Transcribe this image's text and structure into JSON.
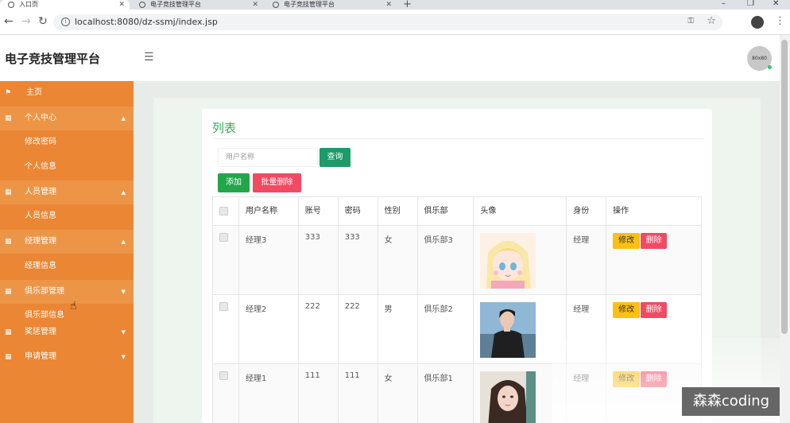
{
  "browser": {
    "tabs": [
      {
        "title": "入口页"
      },
      {
        "title": "电子竞技管理平台"
      },
      {
        "title": "电子竞技管理平台"
      }
    ],
    "new_tab": "+",
    "url": "localhost:8080/dz-ssmj/index.jsp",
    "window_controls": {
      "minimize": "–",
      "restore": "❐",
      "close": "✕"
    }
  },
  "header": {
    "brand": "电子竞技管理平台",
    "avatar_text": "80x80"
  },
  "sidebar": {
    "items": [
      {
        "label": "主页",
        "icon": "flag-icon",
        "type": "top"
      },
      {
        "label": "个人中心",
        "icon": "grid-icon",
        "type": "group"
      },
      {
        "label": "修改密码",
        "type": "sub"
      },
      {
        "label": "个人信息",
        "type": "sub"
      },
      {
        "label": "人员管理",
        "icon": "grid-icon",
        "type": "group"
      },
      {
        "label": "人员信息",
        "type": "sub"
      },
      {
        "label": "经理管理",
        "icon": "grid-icon",
        "type": "group"
      },
      {
        "label": "经理信息",
        "type": "sub"
      },
      {
        "label": "俱乐部管理",
        "icon": "grid-icon",
        "type": "group"
      },
      {
        "label": "俱乐部信息",
        "type": "sub"
      },
      {
        "label": "奖惩管理",
        "icon": "grid-icon",
        "type": "group"
      },
      {
        "label": "申请管理",
        "icon": "grid-icon",
        "type": "group"
      }
    ]
  },
  "main": {
    "title": "列表",
    "search": {
      "placeholder": "用户名称",
      "button": "查询"
    },
    "actions": {
      "add": "添加",
      "batch_delete": "批量删除"
    },
    "table": {
      "columns": [
        "用户名称",
        "账号",
        "密码",
        "性别",
        "俱乐部",
        "头像",
        "身份",
        "操作"
      ],
      "rows": [
        {
          "name": "经理3",
          "account": "333",
          "password": "333",
          "gender": "女",
          "club": "俱乐部3",
          "avatar": "anime-girl-avatar",
          "role": "经理"
        },
        {
          "name": "经理2",
          "account": "222",
          "password": "222",
          "gender": "男",
          "club": "俱乐部2",
          "avatar": "young-man-photo",
          "role": "经理"
        },
        {
          "name": "经理1",
          "account": "111",
          "password": "111",
          "gender": "女",
          "club": "俱乐部1",
          "avatar": "woman-illustration",
          "role": "经理"
        }
      ],
      "row_actions": {
        "edit": "修改",
        "delete": "删除"
      }
    }
  },
  "watermark": "森森coding",
  "colors": {
    "sidebar": "#ea8634",
    "title_green": "#3aa85a",
    "query": "#1a9c6b",
    "add": "#23a64a",
    "danger": "#f24a62",
    "warning": "#fcbf13"
  }
}
